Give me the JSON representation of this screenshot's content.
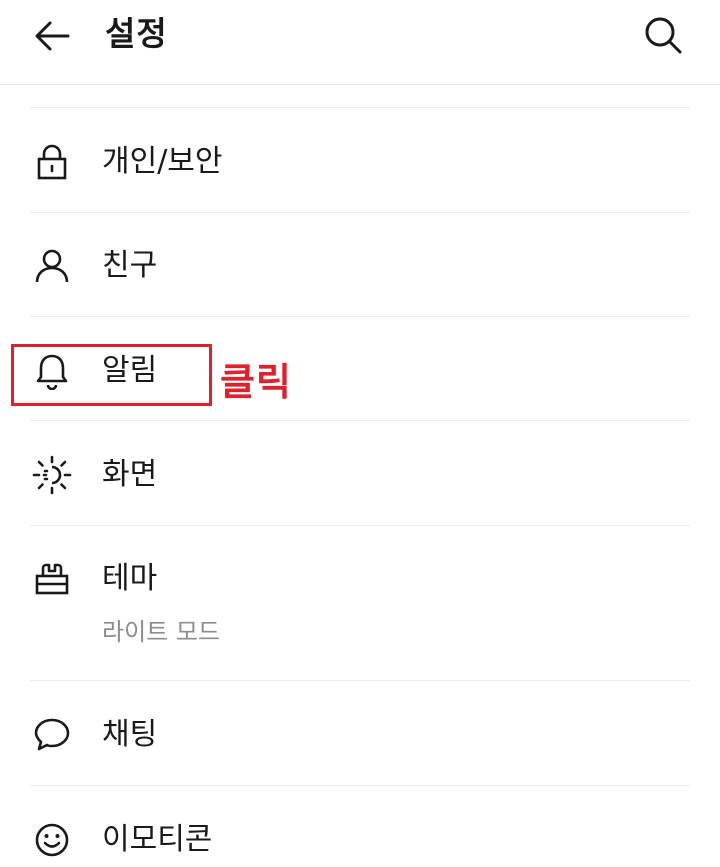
{
  "header": {
    "title": "설정",
    "back_icon": "arrow-left-icon",
    "search_icon": "search-icon"
  },
  "menu": [
    {
      "label": "개인/보안",
      "icon": "lock-icon"
    },
    {
      "label": "친구",
      "icon": "person-icon"
    },
    {
      "label": "알림",
      "icon": "bell-icon"
    },
    {
      "label": "화면",
      "icon": "brightness-icon"
    },
    {
      "label": "테마",
      "icon": "paint-brush-icon",
      "sublabel": "라이트 모드"
    },
    {
      "label": "채팅",
      "icon": "chat-bubble-icon"
    },
    {
      "label": "이모티콘",
      "icon": "smiley-icon"
    }
  ],
  "annotation": {
    "text": "클릭",
    "color": "#e0202a",
    "target": "알림"
  }
}
